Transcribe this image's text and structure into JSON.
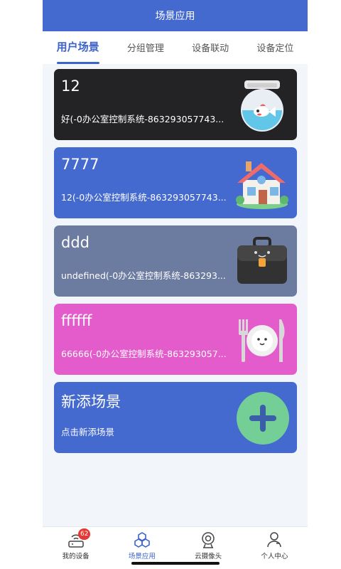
{
  "header": {
    "title": "场景应用"
  },
  "tabs": [
    {
      "label": "用户场景"
    },
    {
      "label": "分组管理"
    },
    {
      "label": "设备联动"
    },
    {
      "label": "设备定位"
    }
  ],
  "scenes": [
    {
      "title": "12",
      "subtitle": "好(-0办公室控制系统-863293057743...",
      "color": "#232325",
      "icon": "fishbowl-icon"
    },
    {
      "title": "7777",
      "subtitle": "12(-0办公室控制系统-863293057743...",
      "color": "#4469cf",
      "icon": "house-icon"
    },
    {
      "title": "ddd",
      "subtitle": "undefined(-0办公室控制系统-863293...",
      "color": "#6c7ba0",
      "icon": "briefcase-icon"
    },
    {
      "title": "ffffff",
      "subtitle": "66666(-0办公室控制系统-863293057...",
      "color": "#e45ccb",
      "icon": "dinner-plate-icon"
    },
    {
      "title": "新添场景",
      "subtitle": "点击新添场景",
      "color": "#4469cf",
      "icon": "add-icon"
    }
  ],
  "tabbar": [
    {
      "label": "我的设备",
      "badge": "62",
      "icon": "router-icon"
    },
    {
      "label": "场景应用",
      "icon": "hexagons-icon"
    },
    {
      "label": "云摄像头",
      "icon": "camera-icon"
    },
    {
      "label": "个人中心",
      "icon": "person-icon"
    }
  ]
}
